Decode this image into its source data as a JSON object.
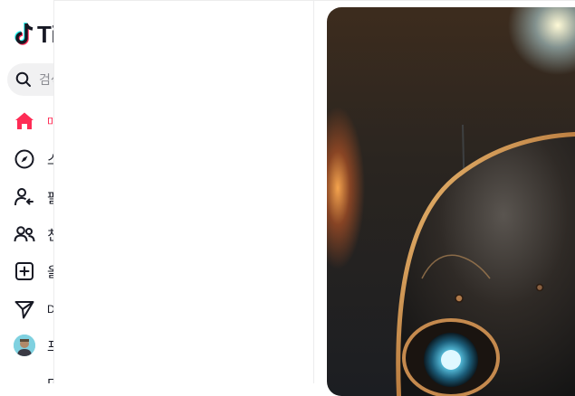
{
  "app": {
    "logo_text": "Ti"
  },
  "search": {
    "placeholder": "검색"
  },
  "nav": {
    "items": [
      {
        "label": "마",
        "icon": "home-icon",
        "active": true
      },
      {
        "label": "스",
        "icon": "compass-icon"
      },
      {
        "label": "팔",
        "icon": "following-icon"
      },
      {
        "label": "친",
        "icon": "friends-icon"
      },
      {
        "label": "올",
        "icon": "upload-icon"
      },
      {
        "label": "D",
        "icon": "send-icon"
      },
      {
        "label": "프",
        "icon": "avatar"
      },
      {
        "label": "더",
        "icon": "more-icon"
      }
    ]
  },
  "colors": {
    "accent": "#fe2c55",
    "text": "#161823",
    "divider": "#ececed"
  },
  "video": {
    "description_visible": false
  }
}
